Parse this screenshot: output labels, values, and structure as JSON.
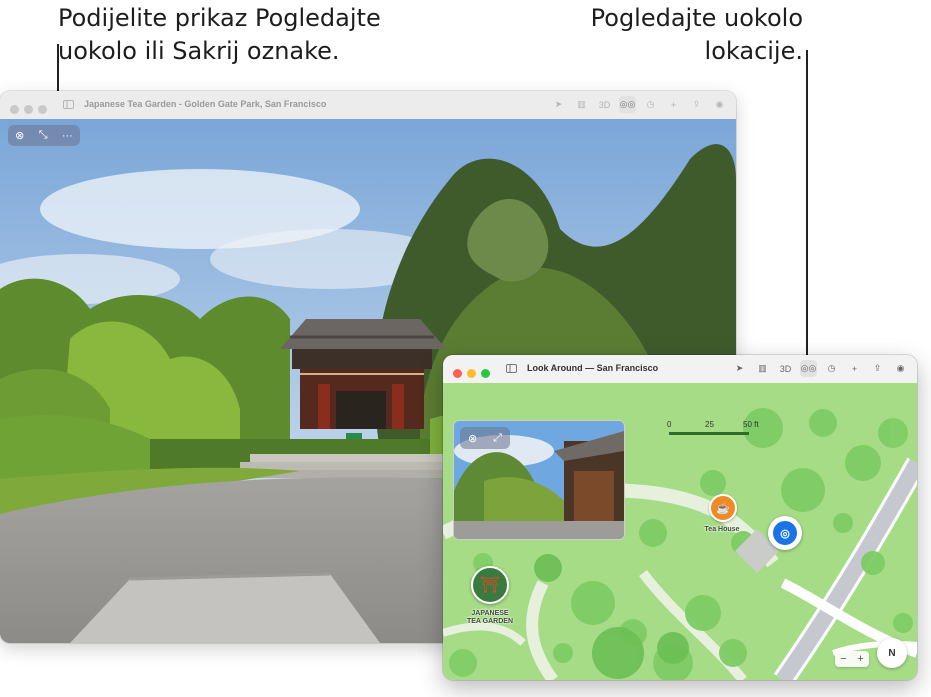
{
  "callouts": {
    "left_line1": "Podijelite prikaz Pogledajte",
    "left_line2": "uokolo ili Sakrij oznake.",
    "right_line1": "Pogledajte uokolo",
    "right_line2": "lokacije."
  },
  "window_main": {
    "title": "Japanese Tea Garden - Golden Gate Park, San Francisco",
    "toolbar": {
      "label_3d": "3D"
    },
    "look_around_controls": {
      "close": "⊗",
      "collapse": "⤡",
      "more": "···"
    }
  },
  "window_map": {
    "title": "Look Around — San Francisco",
    "toolbar": {
      "label_3d": "3D"
    },
    "preview_controls": {
      "close": "⊗",
      "expand": "⤢"
    },
    "scale": {
      "zero": "0",
      "mid": "25",
      "end": "50 ft"
    },
    "places": {
      "tea_house": "Tea House",
      "garden_line1": "JAPANESE",
      "garden_line2": "TEA GARDEN"
    },
    "compass": "N",
    "zoom": {
      "minus": "−",
      "plus": "+"
    }
  },
  "colors": {
    "park_green": "#a6dc86",
    "tree_green": "#7fcc66",
    "path": "#e8f0e2",
    "road": "#c9ccd0",
    "marker_orange": "#f08a24",
    "marker_blue": "#1a73e8"
  }
}
